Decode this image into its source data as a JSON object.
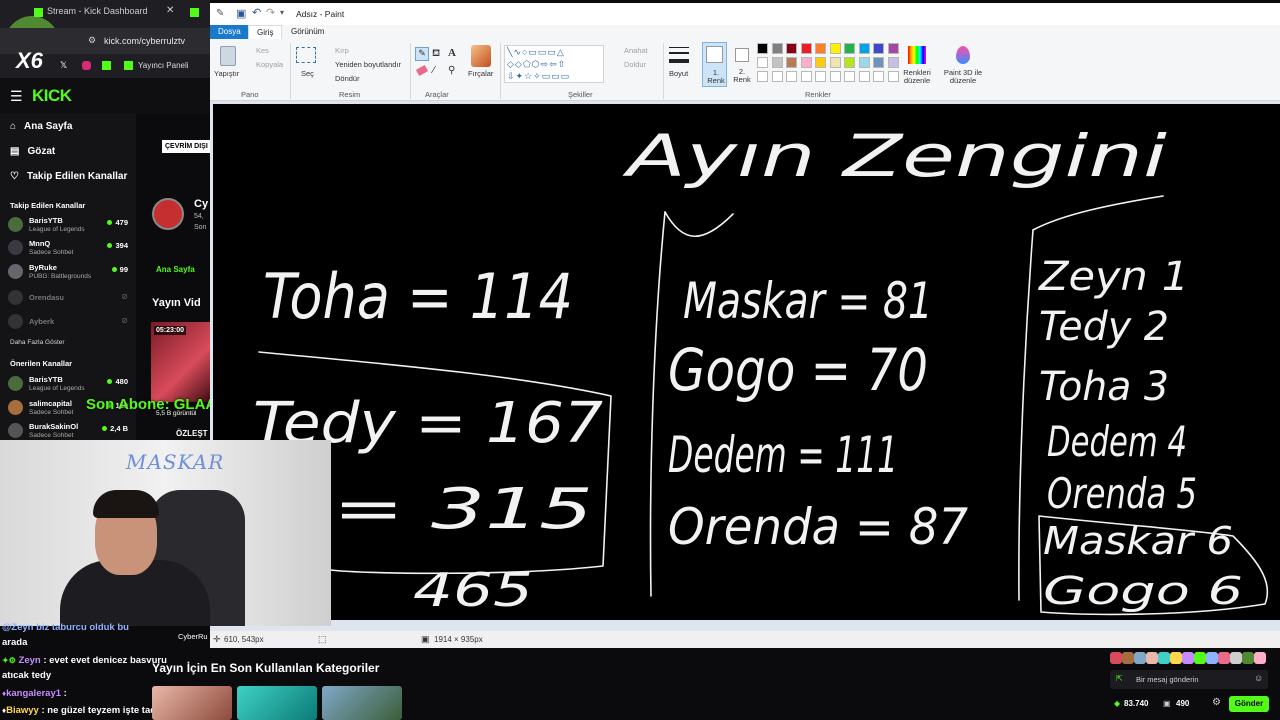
{
  "browser": {
    "tab1": "Stream - Kick Dashboard",
    "url": "kick.com/cyberrulztv",
    "bookmark1": "Yayıncı Paneli",
    "logo_badge": "X6"
  },
  "kick": {
    "logo": "KICK",
    "nav": [
      {
        "label": "Ana Sayfa"
      },
      {
        "label": "Gözat"
      },
      {
        "label": "Takip Edilen Kanallar"
      }
    ],
    "followed_heading": "Takip Edilen Kanallar",
    "followed": [
      {
        "name": "BarisYTB",
        "game": "League of Legends",
        "viewers": "479"
      },
      {
        "name": "MnnQ",
        "game": "Sadece Sohbet",
        "viewers": "394"
      },
      {
        "name": "ByRuke",
        "game": "PUBG: Battlegrounds",
        "viewers": "99"
      },
      {
        "name": "Orendasu",
        "game": "",
        "viewers": ""
      },
      {
        "name": "Ayberk",
        "game": "",
        "viewers": ""
      }
    ],
    "show_more": "Daha Fazla Göster",
    "recommended_heading": "Önerilen Kanallar",
    "recommended": [
      {
        "name": "BarisYTB",
        "game": "League of Legends",
        "viewers": "480"
      },
      {
        "name": "salimcapital",
        "game": "Sadece Sohbet",
        "viewers": "129"
      },
      {
        "name": "BurakSakinOl",
        "game": "Sadece Sohbet",
        "viewers": "2,4 B"
      }
    ],
    "offline_badge": "ÇEVRİM DIŞI",
    "channel_short": "Cy",
    "channel_sub1": "54,",
    "channel_sub2": "Son",
    "home_tab": "Ana Sayfa",
    "section_videos": "Yayın Vid",
    "video_duration": "05:23:00",
    "video_views": "5,5 B görüntül",
    "video_title": "ÖZLEŞT",
    "overlay_text": "Son Abone: GLAAT",
    "webcam_label": "MASKAR"
  },
  "paint": {
    "title": "Adsız - Paint",
    "tabs": [
      "Dosya",
      "Giriş",
      "Görünüm"
    ],
    "groups": {
      "pano": "Pano",
      "resim": "Resim",
      "araclar": "Araçlar",
      "sekiller": "Şekiller",
      "renkler": "Renkler"
    },
    "ribbon": {
      "paste": "Yapıştır",
      "cut": "Kes",
      "copy": "Kopyala",
      "select": "Seç",
      "crop": "Kırp",
      "resize": "Yeniden boyutlandır",
      "rotate": "Döndür",
      "brushes": "Fırçalar",
      "outline": "Anahat",
      "fill": "Doldur",
      "size": "Boyut",
      "color1": "1. Renk",
      "color2": "2. Renk",
      "edit_colors": "Renkleri düzenle",
      "paint3d": "Paint 3D ile düzenle"
    },
    "palette": [
      "#000000",
      "#7f7f7f",
      "#880015",
      "#ed1c24",
      "#ff7f27",
      "#fff200",
      "#22b14c",
      "#00a2e8",
      "#3f48cc",
      "#a349a4",
      "#ffffff",
      "#c3c3c3",
      "#b97a57",
      "#ffaec9",
      "#ffc90e",
      "#efe4b0",
      "#b5e61d",
      "#99d9ea",
      "#7092be",
      "#c8bfe7"
    ],
    "status": {
      "cursor_pos": "610, 543px",
      "image_size": "1914 × 935px"
    },
    "drawing_texts": [
      "Ayın Zengini",
      "Toha = 114",
      "Tedy = 167",
      "= 315",
      "465",
      "Maskar = 81",
      "Gogo = 70",
      "Dedem = 111",
      "Orenda = 87",
      "Zeyn 1",
      "Tedy 2",
      "Toha 3",
      "Dedem 4",
      "Orenda 5",
      "Maskar 6",
      "Gogo 6"
    ]
  },
  "stream": {
    "categories_heading": "Yayın İçin En Son Kullanılan Kategoriler",
    "chat": [
      {
        "user": "",
        "text": "@Zeyn biz taburcu olduk bu"
      },
      {
        "user": "",
        "text": "arada"
      },
      {
        "user": "Zeyn",
        "text": ": evet evet denicez basvuru"
      },
      {
        "user": "",
        "text": "atıcak tedy"
      },
      {
        "user": "kangaleray1",
        "text": ":"
      },
      {
        "user": "Biawyy",
        "text": ": ne güzel teyzem işte tadını çıkar"
      }
    ],
    "chat_placeholder": "Bir mesaj gönderin",
    "points": "83.740",
    "count": "490",
    "send": "Gönder",
    "webcam_caption": "CyberRu"
  },
  "colors": {
    "kick_green": "#53fc18",
    "paint_accent": "#1979ca",
    "canvas": "#000000"
  }
}
